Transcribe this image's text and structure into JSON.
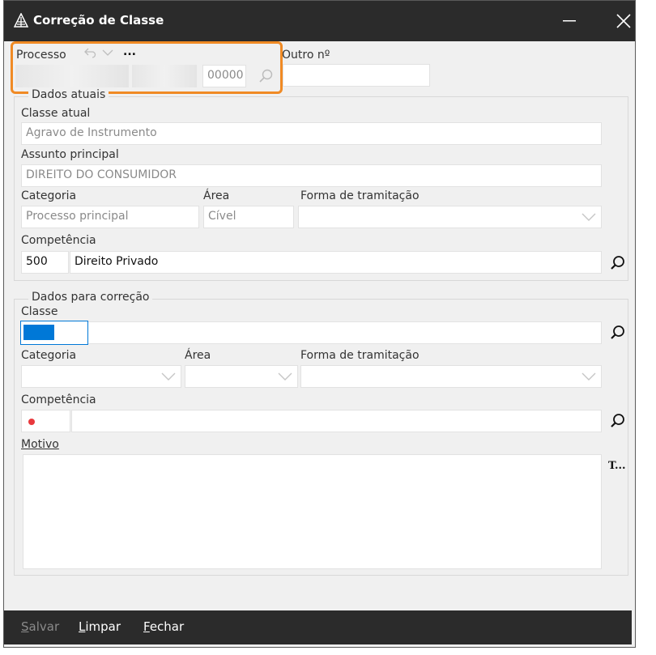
{
  "window": {
    "title": "Correção de Classe"
  },
  "processo": {
    "label": "Processo",
    "more_label": "...",
    "suffix_value": "00000",
    "outro_label": "Outro nº",
    "outro_value": ""
  },
  "dados_atuais": {
    "group_title": "Dados atuais",
    "classe_label": "Classe atual",
    "classe_value": "Agravo de Instrumento",
    "assunto_label": "Assunto principal",
    "assunto_value": "DIREITO DO CONSUMIDOR",
    "categoria_label": "Categoria",
    "categoria_value": "Processo principal",
    "area_label": "Área",
    "area_value": "Cível",
    "forma_label": "Forma de tramitação",
    "forma_value": "",
    "competencia_label": "Competência",
    "competencia_code": "500",
    "competencia_desc": "Direito Privado"
  },
  "dados_correcao": {
    "group_title": "Dados para correção",
    "classe_label": "Classe",
    "categoria_label": "Categoria",
    "area_label": "Área",
    "forma_label": "Forma de tramitação",
    "competencia_label": "Competência",
    "motivo_label": "Motivo",
    "motivo_side_label": "T..."
  },
  "footer": {
    "salvar_first": "S",
    "salvar_rest": "alvar",
    "limpar_first": "L",
    "limpar_rest": "impar",
    "fechar_first": "F",
    "fechar_rest": "echar"
  },
  "colors": {
    "titlebar": "#2b2b2b",
    "highlight": "#f08a24",
    "selection": "#0078d7",
    "required_dot": "#e8393d"
  }
}
